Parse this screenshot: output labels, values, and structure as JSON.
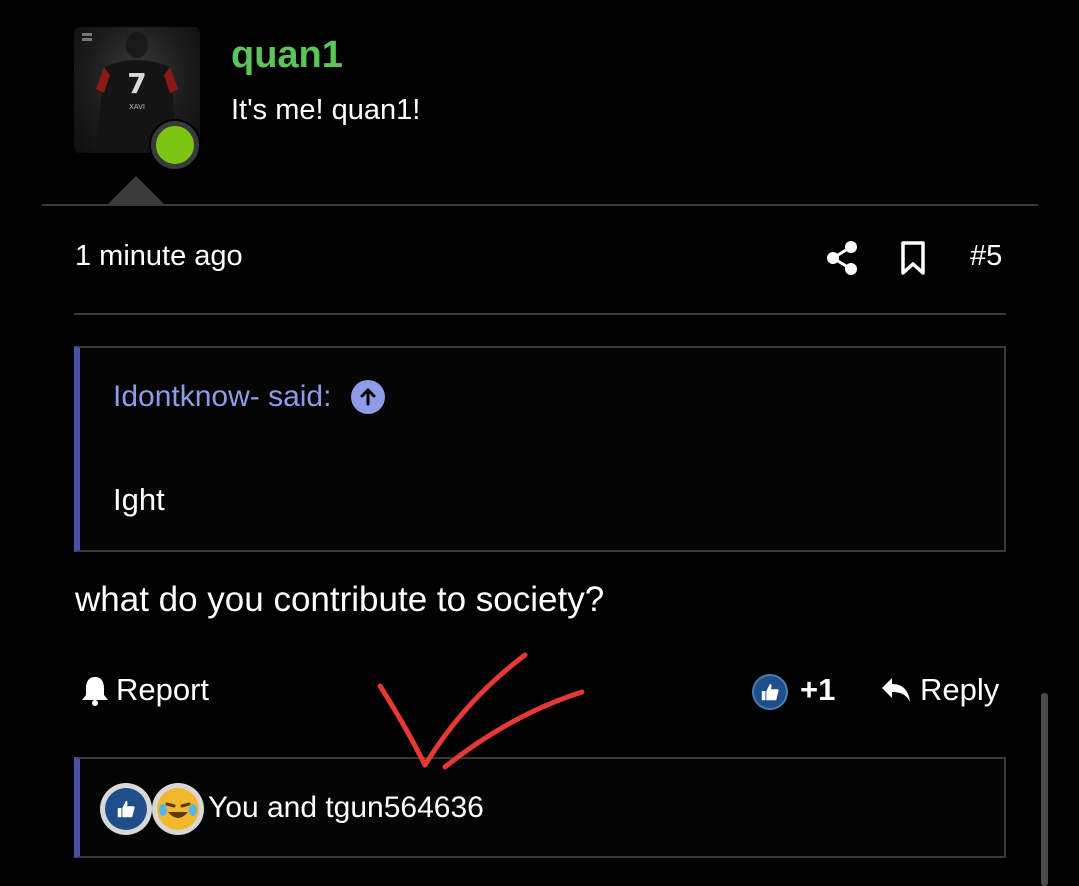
{
  "author": {
    "username": "quan1",
    "user_title": "It's me! quan1!",
    "avatar_icon": "avatar-image",
    "status_color": "#7cc412",
    "jersey_number": "7",
    "jersey_name": "XAVI"
  },
  "post": {
    "time": "1 minute ago",
    "number": "#5",
    "share_icon": "share-icon",
    "bookmark_icon": "bookmark-icon",
    "message": "what do you contribute to society?"
  },
  "quote": {
    "author_label": "Idontknow- said:",
    "jump_icon": "arrow-up-circle-icon",
    "body": "Ight"
  },
  "actions": {
    "report_label": "Report",
    "reaction_count": "+1",
    "reply_label": "Reply"
  },
  "reactions": {
    "summary": "You and tgun564636",
    "icons": [
      "like-icon",
      "laugh-icon"
    ]
  },
  "colors": {
    "username": "#5ac65a",
    "quote_accent": "#4a4fa8",
    "quote_author": "#8e9be8",
    "annotation": "#e53935",
    "background": "#000000"
  }
}
